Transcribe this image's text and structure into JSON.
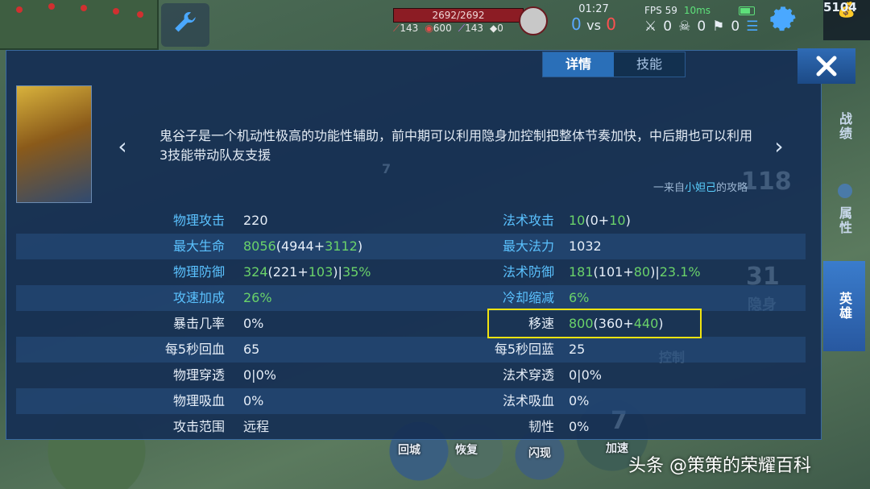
{
  "hud": {
    "hp": "2692/2692",
    "stat_attack": "143",
    "stat_hp": "600",
    "stat_magic": "143",
    "stat_extra": "0",
    "time": "01:27",
    "score_blue": "0",
    "score_vs": "vs",
    "score_red": "0",
    "fps": "FPS 59",
    "ping": "10ms",
    "kills": "0",
    "deaths": "0",
    "assists": "0",
    "gold": "5104"
  },
  "tabs": [
    {
      "label": "详情",
      "active": true
    },
    {
      "label": "技能",
      "active": false
    }
  ],
  "hero": {
    "description": "鬼谷子是一个机动性极高的功能性辅助，前中期可以利用隐身加控制把整体节奏加快，中后期也可以利用3技能带动队友支援",
    "source_prefix": "一来自",
    "source_author": "小妲己",
    "source_suffix": "的攻略"
  },
  "stats": {
    "physical_attack": {
      "label": "物理攻击",
      "value": "220"
    },
    "magic_attack": {
      "label": "法术攻击",
      "total": "10",
      "open": "(",
      "base": "0",
      "plus": "+",
      "bonus": "10",
      "close": ")"
    },
    "max_hp": {
      "label": "最大生命",
      "total": "8056",
      "open": "(",
      "base": "4944",
      "plus": "+",
      "bonus": "3112",
      "close": ")"
    },
    "max_mana": {
      "label": "最大法力",
      "value": "1032"
    },
    "physical_defense": {
      "label": "物理防御",
      "total": "324",
      "open": "(",
      "base": "221",
      "plus": "+",
      "bonus": "103",
      "close": ")|",
      "pct": "35%"
    },
    "magic_defense": {
      "label": "法术防御",
      "total": "181",
      "open": "(",
      "base": "101",
      "plus": "+",
      "bonus": "80",
      "close": ")|",
      "pct": "23.1%"
    },
    "attack_speed": {
      "label": "攻速加成",
      "value": "26%"
    },
    "cooldown": {
      "label": "冷却缩减",
      "value": "6%"
    },
    "crit_rate": {
      "label": "暴击几率",
      "value": "0%"
    },
    "move_speed": {
      "label": "移速",
      "total": "800",
      "open": "(",
      "base": "360",
      "plus": "+",
      "bonus": "440",
      "close": ")"
    },
    "hp_regen": {
      "label": "每5秒回血",
      "value": "65"
    },
    "mana_regen": {
      "label": "每5秒回蓝",
      "value": "25"
    },
    "physical_pen": {
      "label": "物理穿透",
      "value": "0|0%"
    },
    "magic_pen": {
      "label": "法术穿透",
      "value": "0|0%"
    },
    "physical_lifesteal": {
      "label": "物理吸血",
      "value": "0%"
    },
    "magic_lifesteal": {
      "label": "法术吸血",
      "value": "0%"
    },
    "attack_range": {
      "label": "攻击范围",
      "value": "远程"
    },
    "tenacity": {
      "label": "韧性",
      "value": "0%"
    }
  },
  "side_tabs": [
    {
      "label": "战绩",
      "active": false
    },
    {
      "label": "属性",
      "active": false
    },
    {
      "label": "英雄",
      "active": true
    }
  ],
  "bg_text": {
    "level": "7",
    "cd1": "118",
    "cd2": "31",
    "stealth": "隐身",
    "control": "控制",
    "recall": "回城",
    "recover": "恢复",
    "flash": "闪现",
    "accelerate": "加速",
    "skill_num": "7"
  },
  "watermark": "头条 @策策的荣耀百科",
  "colors": {
    "highlight_label": "#5bc2ff",
    "green_value": "#6ad26a",
    "box_yellow": "#f1e310",
    "active_tab": "#2a6fb8"
  },
  "icons": [
    "wrench-icon",
    "gear-icon",
    "money-bag-icon",
    "close-icon",
    "chevron-left-icon",
    "chevron-right-icon",
    "battery-icon",
    "sword-icon",
    "skull-icon",
    "menu-icon"
  ]
}
